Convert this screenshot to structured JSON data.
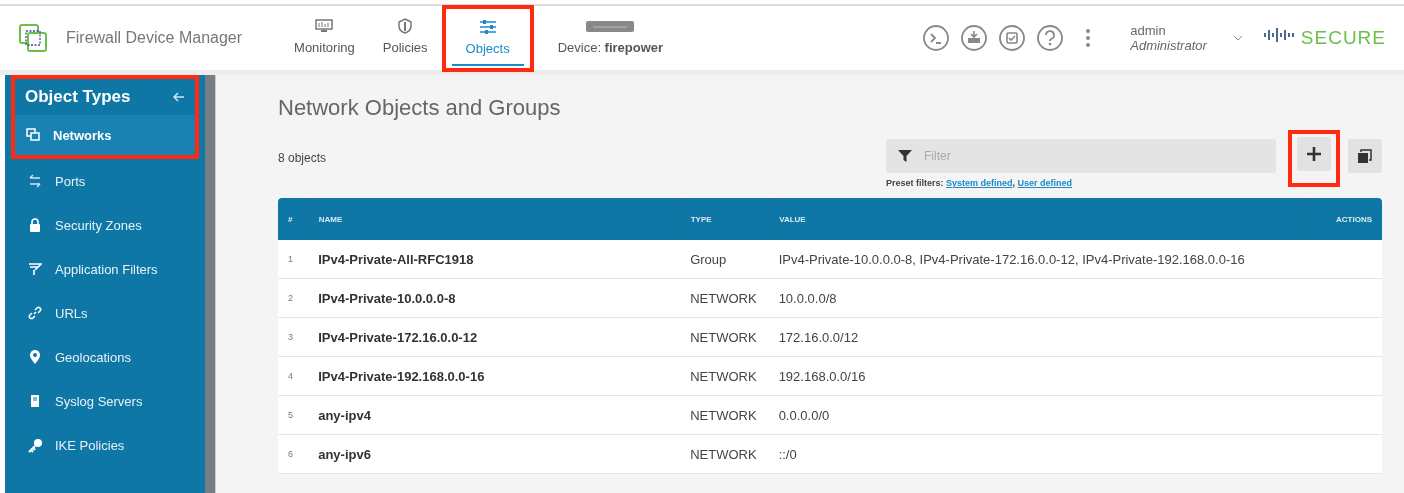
{
  "header": {
    "app_title": "Firewall Device Manager",
    "tabs": [
      {
        "label": "Monitoring",
        "selected": false,
        "highlighted": false
      },
      {
        "label": "Policies",
        "selected": false,
        "highlighted": false
      },
      {
        "label": "Objects",
        "selected": true,
        "highlighted": true
      }
    ],
    "device": {
      "label": "Device:",
      "name": "firepower"
    },
    "tools": [
      {
        "kind": "cli"
      },
      {
        "kind": "deploy"
      },
      {
        "kind": "tasks"
      },
      {
        "kind": "help"
      },
      {
        "kind": "more"
      }
    ],
    "user": {
      "name": "admin",
      "role": "Administrator"
    },
    "brand": {
      "word": "SECURE"
    }
  },
  "sidebar": {
    "title": "Object Types",
    "title_highlighted": true,
    "items": [
      {
        "label": "Networks",
        "selected": true,
        "highlighted": true
      },
      {
        "label": "Ports",
        "selected": false,
        "highlighted": false
      },
      {
        "label": "Security Zones",
        "selected": false,
        "highlighted": false
      },
      {
        "label": "Application Filters",
        "selected": false,
        "highlighted": false
      },
      {
        "label": "URLs",
        "selected": false,
        "highlighted": false
      },
      {
        "label": "Geolocations",
        "selected": false,
        "highlighted": false
      },
      {
        "label": "Syslog Servers",
        "selected": false,
        "highlighted": false
      },
      {
        "label": "IKE Policies",
        "selected": false,
        "highlighted": false
      }
    ]
  },
  "main": {
    "title": "Network Objects and Groups",
    "count": "8 objects",
    "filter": {
      "placeholder": "Filter"
    },
    "preset_label": "Preset filters:",
    "presets": [
      "System defined",
      "User defined"
    ],
    "preset_separator": ",",
    "add_highlighted": true,
    "table": {
      "columns": [
        "#",
        "NAME",
        "TYPE",
        "VALUE",
        "ACTIONS"
      ],
      "rows": [
        [
          "1",
          "IPv4-Private-All-RFC1918",
          "Group",
          "IPv4-Private-10.0.0.0-8, IPv4-Private-172.16.0.0-12, IPv4-Private-192.168.0.0-16"
        ],
        [
          "2",
          "IPv4-Private-10.0.0.0-8",
          "NETWORK",
          "10.0.0.0/8"
        ],
        [
          "3",
          "IPv4-Private-172.16.0.0-12",
          "NETWORK",
          "172.16.0.0/12"
        ],
        [
          "4",
          "IPv4-Private-192.168.0.0-16",
          "NETWORK",
          "192.168.0.0/16"
        ],
        [
          "5",
          "any-ipv4",
          "NETWORK",
          "0.0.0.0/0"
        ],
        [
          "6",
          "any-ipv6",
          "NETWORK",
          "::/0"
        ]
      ]
    }
  }
}
